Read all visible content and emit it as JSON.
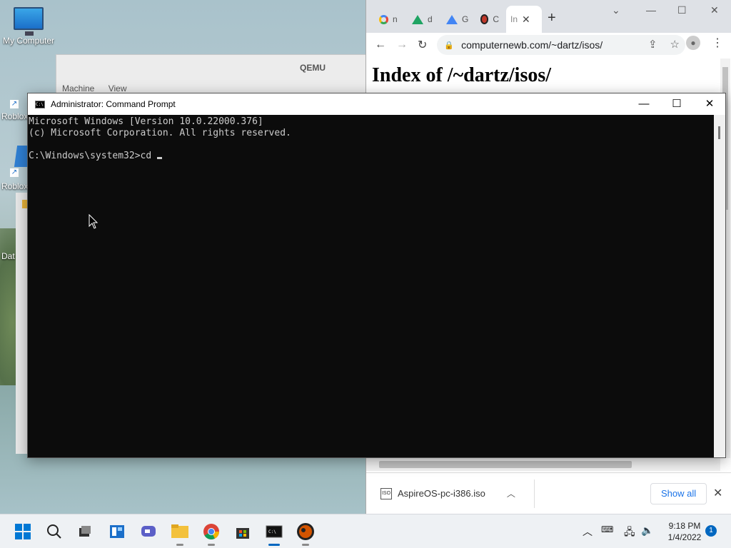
{
  "desktop": {
    "icons": [
      {
        "label": "My Computer"
      },
      {
        "label": "Roblox"
      },
      {
        "label": "Roblox"
      },
      {
        "label": "Dat"
      }
    ]
  },
  "qemu": {
    "title": "QEMU",
    "menu": [
      "Machine",
      "View"
    ]
  },
  "chrome": {
    "tabs": [
      {
        "favicon": "google-icon",
        "label": "n"
      },
      {
        "favicon": "drive-icon",
        "label": "d"
      },
      {
        "favicon": "drive-icon",
        "label": "G"
      },
      {
        "favicon": "bird-icon",
        "label": "C"
      },
      {
        "favicon": "",
        "label": "In"
      }
    ],
    "url": "computernewb.com/~dartz/isos/",
    "page_heading": "Index of /~dartz/isos/",
    "download": {
      "filename": "AspireOS-pc-i386.iso",
      "show_all_label": "Show all"
    }
  },
  "cmd": {
    "title": "Administrator: Command Prompt",
    "lines": [
      "Microsoft Windows [Version 10.0.22000.376]",
      "(c) Microsoft Corporation. All rights reserved.",
      "",
      "C:\\Windows\\system32>cd "
    ]
  },
  "taskbar": {
    "apps": [
      "start-icon",
      "search-icon",
      "task-view-icon",
      "widgets-icon",
      "chat-icon",
      "file-explorer-icon",
      "chrome-icon",
      "store-icon",
      "cmd-icon",
      "app-bird-icon"
    ],
    "clock": {
      "time": "9:18 PM",
      "date": "1/4/2022"
    },
    "notification_count": "1"
  },
  "colors": {
    "accent": "#0067c0",
    "terminal_bg": "#0c0c0c",
    "terminal_fg": "#cccccc",
    "link": "#1a73e8"
  }
}
